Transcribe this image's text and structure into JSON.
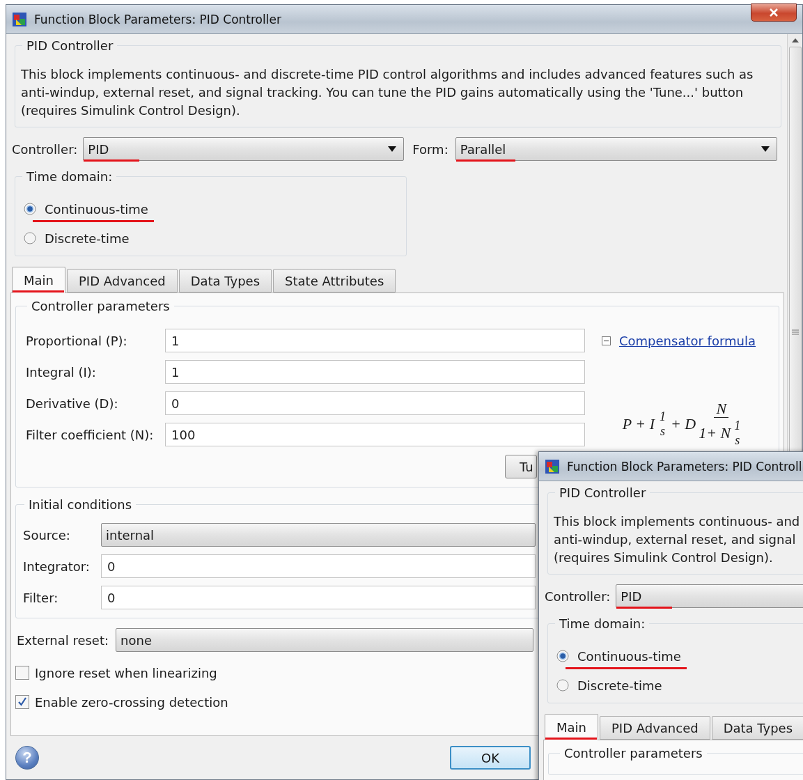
{
  "main_window": {
    "title": "Function Block Parameters: PID Controller",
    "close_button": true,
    "scrollbar": true,
    "block": {
      "title": "PID Controller",
      "description_lines": [
        "This block implements continuous- and discrete-time PID control algorithms and includes advanced features such as",
        "anti-windup, external reset, and signal tracking. You can tune the PID gains automatically using the 'Tune...' button",
        "(requires Simulink Control Design)."
      ]
    },
    "controller": {
      "label": "Controller:",
      "value": "PID",
      "underlined": true
    },
    "form": {
      "label": "Form:",
      "value": "Parallel",
      "underlined": true
    },
    "time_domain": {
      "title": "Time domain:",
      "options": [
        {
          "label": "Continuous-time",
          "selected": true,
          "underlined": true
        },
        {
          "label": "Discrete-time",
          "selected": false,
          "underlined": false
        }
      ]
    },
    "tabs": [
      {
        "label": "Main",
        "selected": true,
        "underlined": true
      },
      {
        "label": "PID Advanced",
        "selected": false,
        "underlined": false
      },
      {
        "label": "Data Types",
        "selected": false,
        "underlined": false
      },
      {
        "label": "State Attributes",
        "selected": false,
        "underlined": false
      }
    ],
    "controller_parameters": {
      "title": "Controller parameters",
      "fields": [
        {
          "label": "Proportional (P):",
          "value": "1"
        },
        {
          "label": "Integral (I):",
          "value": "1"
        },
        {
          "label": "Derivative (D):",
          "value": "0"
        },
        {
          "label": "Filter coefficient (N):",
          "value": "100"
        }
      ],
      "link": {
        "label": "Compensator formula",
        "expanded": true
      },
      "formula": {
        "prefix": "P + I",
        "frac_1": [
          "1",
          "s"
        ],
        "middle": "+ D",
        "numerator": "N",
        "denominator_lead": "1+ N",
        "frac_2": [
          "1",
          "s"
        ]
      },
      "tune_button": "Tu"
    },
    "initial_conditions": {
      "title": "Initial conditions",
      "source": {
        "label": "Source:",
        "value": "internal"
      },
      "fields": [
        {
          "label": "Integrator:",
          "value": "0"
        },
        {
          "label": "Filter:",
          "value": "0"
        }
      ]
    },
    "external_reset": {
      "label": "External reset:",
      "value": "none"
    },
    "checkboxes": [
      {
        "label": "Ignore reset when linearizing",
        "checked": false
      },
      {
        "label": "Enable zero-crossing detection",
        "checked": true
      }
    ],
    "help_button": "?",
    "ok_button": "OK"
  },
  "overlay_window": {
    "title": "Function Block Parameters: PID Controll",
    "block": {
      "title": "PID Controller",
      "description_lines": [
        "This block implements continuous- and",
        "anti-windup, external reset, and signal",
        "(requires Simulink Control Design)."
      ]
    },
    "controller": {
      "label": "Controller:",
      "value": "PID",
      "underlined": true
    },
    "time_domain": {
      "title": "Time domain:",
      "options": [
        {
          "label": "Continuous-time",
          "selected": true,
          "underlined": true
        },
        {
          "label": "Discrete-time",
          "selected": false,
          "underlined": false
        }
      ]
    },
    "tabs": [
      {
        "label": "Main",
        "selected": true,
        "underlined": true
      },
      {
        "label": "PID Advanced",
        "selected": false,
        "underlined": false
      },
      {
        "label": "Data Types",
        "selected": false,
        "underlined": false
      }
    ],
    "controller_parameters": {
      "title": "Controller parameters"
    }
  }
}
